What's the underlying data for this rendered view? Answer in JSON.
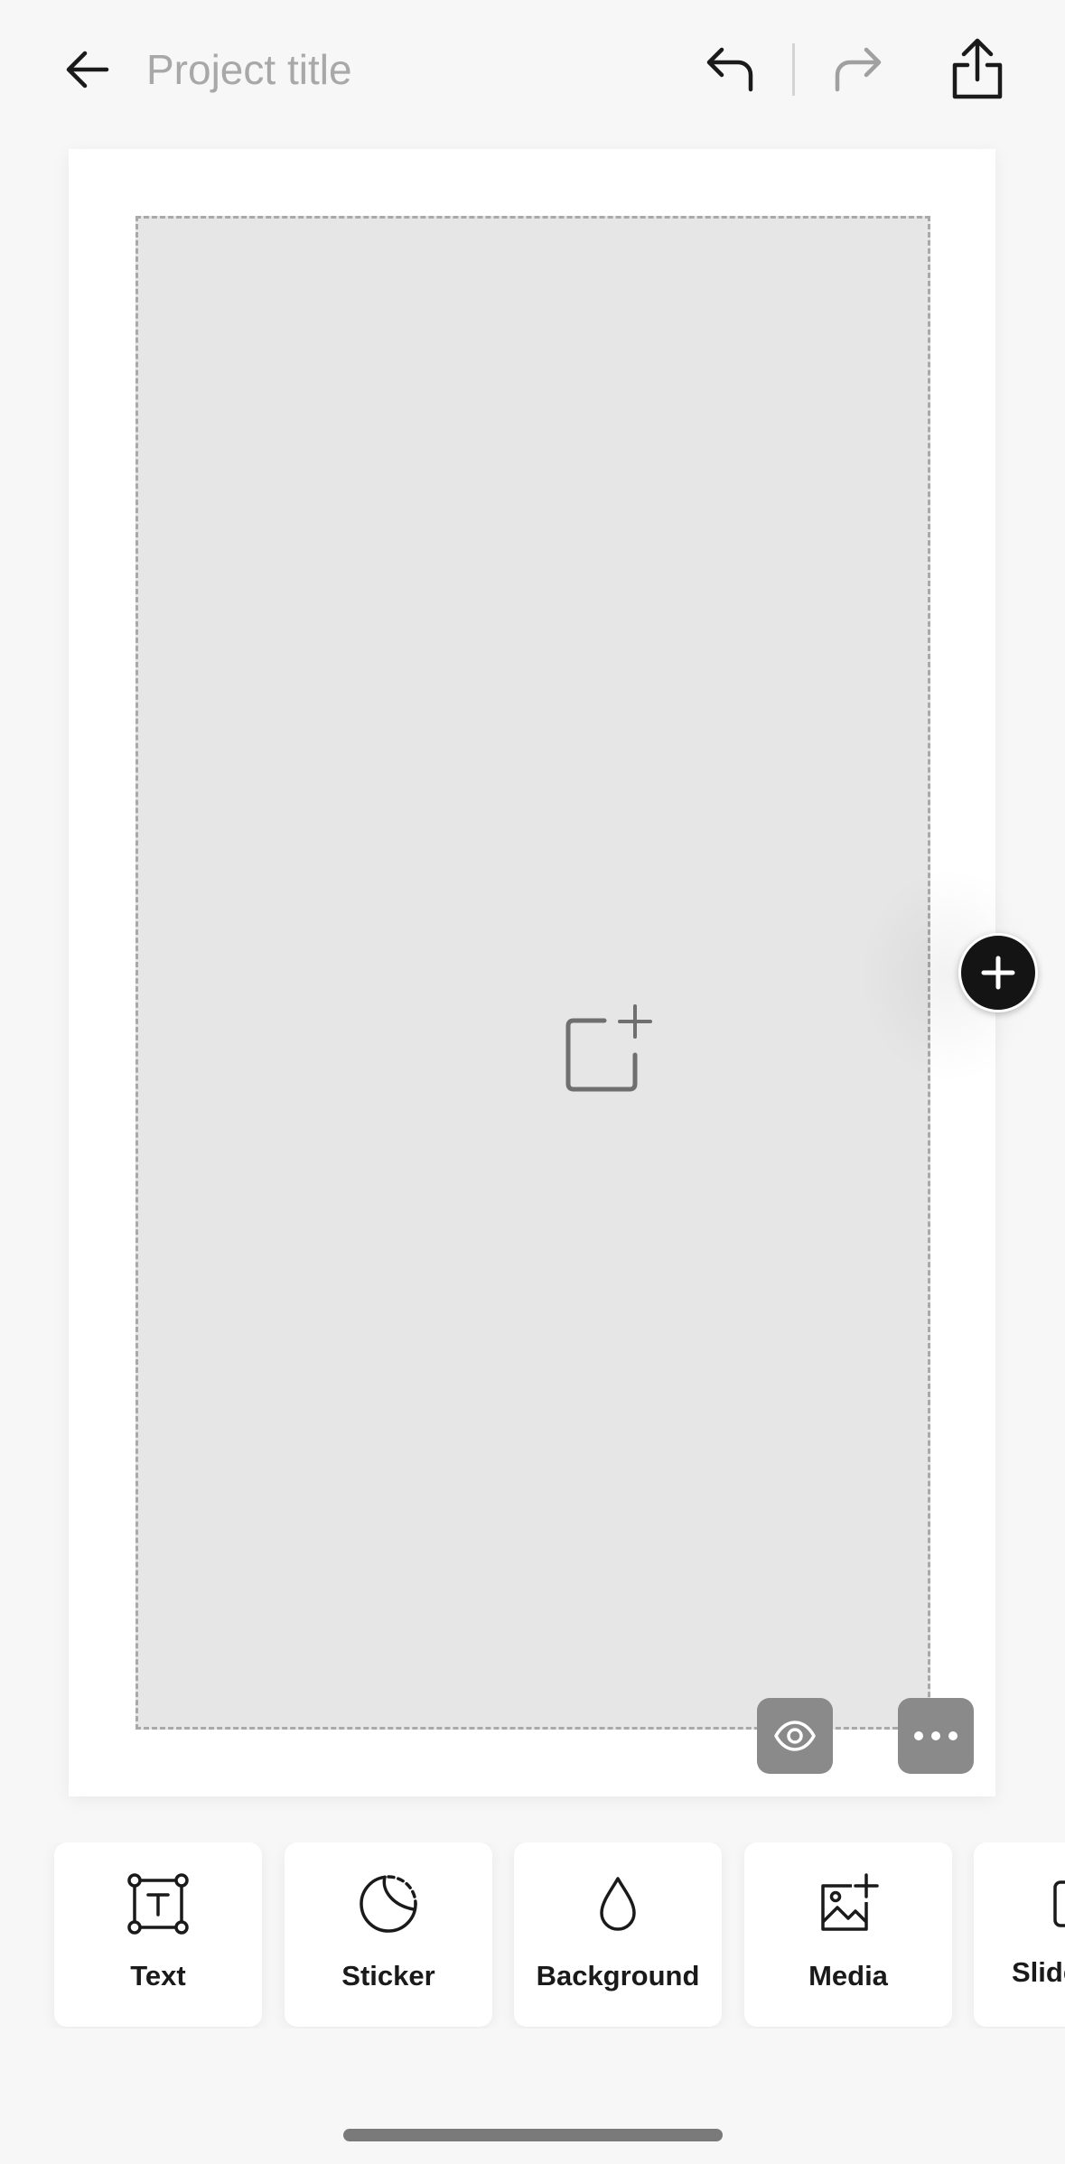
{
  "header": {
    "title_value": "",
    "title_placeholder": "Project title",
    "icons": {
      "back": "arrow-left-icon",
      "undo": "undo-icon",
      "redo": "redo-icon",
      "share": "share-icon"
    }
  },
  "canvas": {
    "add_media_icon": "add-media-icon",
    "preview_icon": "eye-icon",
    "more_icon": "more-horizontal-icon",
    "add_page_icon": "plus-icon"
  },
  "toolbar": {
    "items": [
      {
        "label": "Text",
        "icon": "text-frame-icon"
      },
      {
        "label": "Sticker",
        "icon": "sticker-icon"
      },
      {
        "label": "Background",
        "icon": "droplet-icon"
      },
      {
        "label": "Media",
        "icon": "image-plus-icon"
      },
      {
        "label": "Slide",
        "icon": "slide-icon"
      }
    ]
  },
  "colors": {
    "screen_bg": "#f7f7f7",
    "canvas_bg": "#ffffff",
    "drop_zone_bg": "#e6e6e6",
    "overlay_button": "#8a8a8a",
    "add_page_button": "#141414",
    "placeholder_text": "#a8a8a8"
  }
}
